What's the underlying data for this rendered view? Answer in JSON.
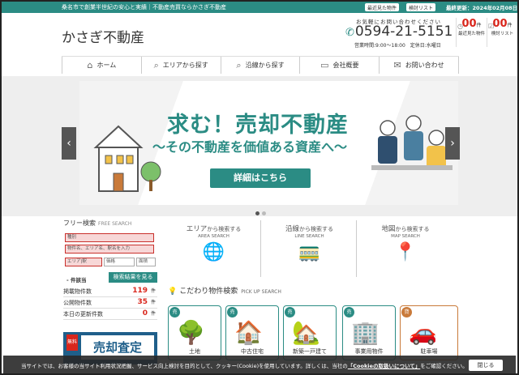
{
  "topbar": {
    "tagline": "桑名市で創業半世紀の安心と実績｜不動産売買ならかさぎ不動産",
    "recent_btn": "最近見た物件",
    "saved_btn": "検討リスト",
    "updated": "最終更新：2024年02月08日"
  },
  "header": {
    "logo": "かさぎ不動産",
    "contact_lead": "お気軽にお問い合わせください",
    "phone": "0594-21-5151",
    "hours": "営業時間:9:00～18:00　定休日:水曜日",
    "recent": {
      "count": "00",
      "unit": "件",
      "label": "最近見た物件"
    },
    "saved": {
      "count": "00",
      "unit": "件",
      "label": "検討リスト"
    }
  },
  "nav": [
    {
      "label": "ホーム",
      "icon": "home-icon",
      "glyph": "⌂"
    },
    {
      "label": "エリアから探す",
      "icon": "search-icon",
      "glyph": "⌕"
    },
    {
      "label": "沿線から探す",
      "icon": "search-icon",
      "glyph": "⌕"
    },
    {
      "label": "会社概要",
      "icon": "book-icon",
      "glyph": "▭"
    },
    {
      "label": "お問い合わせ",
      "icon": "mail-icon",
      "glyph": "✉"
    }
  ],
  "hero": {
    "title": "求む！売却不動産",
    "subtitle": "～その不動産を価値ある資産へ～",
    "button": "詳細はこちら",
    "prev": "‹",
    "next": "›"
  },
  "free_search": {
    "title": "フリー検索",
    "title_en": "FREE SEARCH",
    "type": "種別",
    "keyword": "物件名、エリア名、駅名を入力",
    "area": "エリア|駅",
    "price": "価格",
    "size": "面積",
    "count": "- 件該当",
    "submit": "検索結果を見る"
  },
  "stats": [
    {
      "label": "掲載物件数",
      "value": "119",
      "unit": "件"
    },
    {
      "label": "公開物件数",
      "value": "35",
      "unit": "件"
    },
    {
      "label": "本日の更新件数",
      "value": "0",
      "unit": "件"
    }
  ],
  "sell_banner": {
    "badge": "無料",
    "text": "売却査定"
  },
  "search_boxes": [
    {
      "main": "エリア",
      "small": "から検索する",
      "en": "AREA SEARCH",
      "icon": "globe-icon",
      "glyph": "🌐"
    },
    {
      "main": "沿線",
      "small": "から検索する",
      "en": "LINE SEARCH",
      "icon": "train-icon",
      "glyph": "🚃"
    },
    {
      "main": "地図",
      "small": "から検索する",
      "en": "MAP SEARCH",
      "icon": "map-pin-icon",
      "glyph": "📍"
    }
  ],
  "pickup": {
    "title": "こだわり物件検索",
    "title_en": "PICK UP SEARCH",
    "cards": [
      {
        "tag": "売",
        "label": "土地",
        "icon": "tree-icon",
        "glyph": "🌳",
        "color": "teal"
      },
      {
        "tag": "売",
        "label": "中古住宅",
        "icon": "house-icon",
        "glyph": "🏠",
        "color": "teal"
      },
      {
        "tag": "売",
        "label": "新築一戸建て",
        "icon": "new-house-icon",
        "glyph": "🏡",
        "color": "teal"
      },
      {
        "tag": "売",
        "label": "事業用物件",
        "icon": "building-icon",
        "glyph": "🏢",
        "color": "teal"
      },
      {
        "tag": "貸",
        "label": "駐車場",
        "icon": "car-icon",
        "glyph": "🚗",
        "color": "orange"
      }
    ]
  },
  "cookie": {
    "message_before": "当サイトでは、お客様の当サイト利用状況把握、サービス向上検討を目的として、クッキー(Cookie)を使用しています。詳しくは、当社の",
    "link": "「Cookieの取扱いについて」",
    "message_after": "をご確認ください。",
    "close": "閉じる"
  },
  "colors": {
    "accent": "#2b8c84",
    "price_red": "#d9261c",
    "orange": "#c97a3a"
  }
}
